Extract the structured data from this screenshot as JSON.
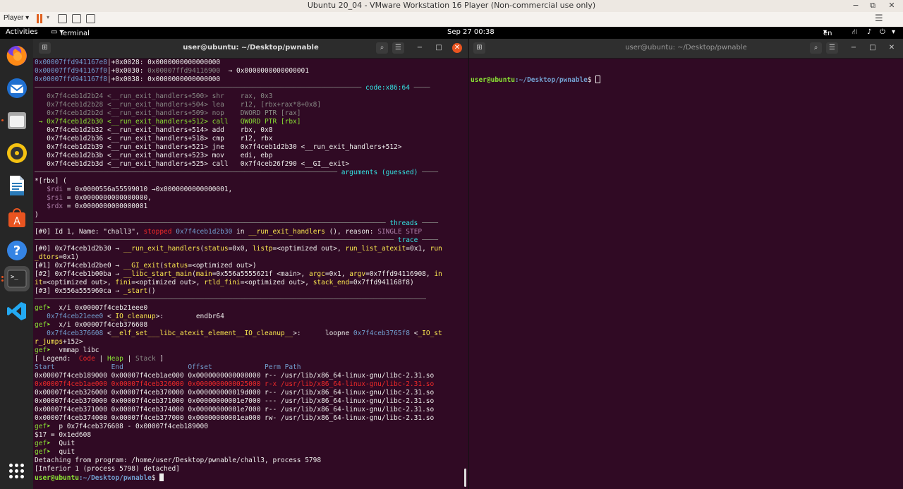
{
  "vmware": {
    "title": "Ubuntu 20_04 - VMware Workstation 16 Player (Non-commercial use only)",
    "player_menu": "Player",
    "minimize": "−",
    "restore": "⧉",
    "close": "✕",
    "accent": "#e0611f"
  },
  "topbar": {
    "activities": "Activities",
    "app_menu": "Terminal",
    "clock": "Sep 27  00:38",
    "lang": "en"
  },
  "dock": {
    "items": [
      "firefox-icon",
      "thunderbird-icon",
      "files-icon",
      "rhythmbox-icon",
      "libreoffice-writer-icon",
      "ubuntu-software-icon",
      "help-icon",
      "terminal-icon",
      "vscode-icon"
    ],
    "apps_grid": "show-applications-icon"
  },
  "left_terminal": {
    "title": "user@ubuntu: ~/Desktop/pwnable",
    "lines": [
      [
        [
          "b",
          "0x00007ffd941167e8"
        ],
        [
          "w",
          "│+0x0028: 0x0000000000000000"
        ]
      ],
      [
        [
          "b",
          "0x00007ffd941167f0"
        ],
        [
          "w",
          "│+0x0030: "
        ],
        [
          "gy",
          "0x00007ffd94116900"
        ],
        [
          "w",
          "  → 0x0000000000000001"
        ]
      ],
      [
        [
          "b",
          "0x00007ffd941167f8"
        ],
        [
          "w",
          "│+0x0038: 0x0000000000000000"
        ]
      ],
      [
        [
          "gy",
          "───────────────────────────────────────────────────────────────────────────────── "
        ],
        [
          "c",
          "code:x86:64"
        ],
        [
          "gy",
          " ────"
        ]
      ],
      [
        [
          "gy",
          "   0x7f4ceb1d2b24 <__run_exit_handlers+500> shr    rax, 0x3"
        ]
      ],
      [
        [
          "gy",
          "   0x7f4ceb1d2b28 <__run_exit_handlers+504> lea    r12, [rbx+rax*8+0x8]"
        ]
      ],
      [
        [
          "gy",
          "   0x7f4ceb1d2b2d <__run_exit_handlers+509> nop    DWORD PTR [rax]"
        ]
      ],
      [
        [
          "g",
          " → 0x7f4ceb1d2b30 <__run_exit_handlers+512> call   QWORD PTR [rbx]"
        ]
      ],
      [
        [
          "w",
          "   0x7f4ceb1d2b32 <__run_exit_handlers+514> add    rbx, 0x8"
        ]
      ],
      [
        [
          "w",
          "   0x7f4ceb1d2b36 <__run_exit_handlers+518> cmp    r12, rbx"
        ]
      ],
      [
        [
          "w",
          "   0x7f4ceb1d2b39 <__run_exit_handlers+521> jne    0x7f4ceb1d2b30 <__run_exit_handlers+512>"
        ]
      ],
      [
        [
          "w",
          "   0x7f4ceb1d2b3b <__run_exit_handlers+523> mov    edi, ebp"
        ]
      ],
      [
        [
          "w",
          "   0x7f4ceb1d2b3d <__run_exit_handlers+525> call   0x7f4ceb26f290 <__GI__exit>"
        ]
      ],
      [
        [
          "gy",
          "─────────────────────────────────────────────────────────────────────────── "
        ],
        [
          "c",
          "arguments (guessed)"
        ],
        [
          "gy",
          " ────"
        ]
      ],
      [
        [
          "w",
          "*[rbx] ("
        ]
      ],
      [
        [
          "w",
          "   "
        ],
        [
          "p",
          "$rdi"
        ],
        [
          "w",
          " = 0x0000556a55599010 →0x0000000000000001,"
        ]
      ],
      [
        [
          "w",
          "   "
        ],
        [
          "p",
          "$rsi"
        ],
        [
          "w",
          " = 0x0000000000000000,"
        ]
      ],
      [
        [
          "w",
          "   "
        ],
        [
          "p",
          "$rdx"
        ],
        [
          "w",
          " = 0x0000000000000001"
        ]
      ],
      [
        [
          "w",
          ")"
        ]
      ],
      [
        [
          "gy",
          "─────────────────────────────────────────────────────────────────────────────────────── "
        ],
        [
          "c",
          "threads"
        ],
        [
          "gy",
          " ────"
        ]
      ],
      [
        [
          "w",
          "[#0] Id 1, Name: \"chall3\", "
        ],
        [
          "r",
          "stopped"
        ],
        [
          "w",
          " "
        ],
        [
          "b",
          "0x7f4ceb1d2b30"
        ],
        [
          "w",
          " in "
        ],
        [
          "y",
          "__run_exit_handlers"
        ],
        [
          "w",
          " (), reason: "
        ],
        [
          "p",
          "SINGLE STEP"
        ]
      ],
      [
        [
          "gy",
          "───────────────────────────────────────────────────────────────────────────────────────── "
        ],
        [
          "c",
          "trace"
        ],
        [
          "gy",
          " ────"
        ]
      ],
      [
        [
          "w",
          "[#0] 0x7f4ceb1d2b30 → "
        ],
        [
          "y",
          "__run_exit_handlers"
        ],
        [
          "w",
          "("
        ],
        [
          "y",
          "status"
        ],
        [
          "w",
          "=0x0, "
        ],
        [
          "y",
          "listp"
        ],
        [
          "w",
          "=<optimized out>, "
        ],
        [
          "y",
          "run_list_atexit"
        ],
        [
          "w",
          "=0x1, "
        ],
        [
          "y",
          "run"
        ]
      ],
      [
        [
          "y",
          "_dtors"
        ],
        [
          "w",
          "=0x1)"
        ]
      ],
      [
        [
          "w",
          "[#1] 0x7f4ceb1d2be0 → "
        ],
        [
          "y",
          "__GI_exit"
        ],
        [
          "w",
          "("
        ],
        [
          "y",
          "status"
        ],
        [
          "w",
          "=<optimized out>)"
        ]
      ],
      [
        [
          "w",
          "[#2] 0x7f4ceb1b00ba → "
        ],
        [
          "y",
          "__libc_start_main"
        ],
        [
          "w",
          "("
        ],
        [
          "y",
          "main"
        ],
        [
          "w",
          "=0x556a5555621f <main>, "
        ],
        [
          "y",
          "argc"
        ],
        [
          "w",
          "=0x1, "
        ],
        [
          "y",
          "argv"
        ],
        [
          "w",
          "=0x7ffd94116908, "
        ],
        [
          "y",
          "in"
        ]
      ],
      [
        [
          "y",
          "it"
        ],
        [
          "w",
          "=<optimized out>, "
        ],
        [
          "y",
          "fini"
        ],
        [
          "w",
          "=<optimized out>, "
        ],
        [
          "y",
          "rtld_fini"
        ],
        [
          "w",
          "=<optimized out>, "
        ],
        [
          "y",
          "stack_end"
        ],
        [
          "w",
          "=0x7ffd941168f8)"
        ]
      ],
      [
        [
          "w",
          "[#3] 0x556a555960ca → "
        ],
        [
          "y",
          "_start"
        ],
        [
          "w",
          "()"
        ]
      ],
      [
        [
          "gy",
          "─────────────────────────────────────────────────────────────────────────────────────────────────"
        ]
      ],
      [
        [
          "g",
          "gef➤"
        ],
        [
          "w",
          "  x/i 0x00007f4ceb21eee0"
        ]
      ],
      [
        [
          "w",
          "   "
        ],
        [
          "b",
          "0x7f4ceb21eee0"
        ],
        [
          "w",
          " <"
        ],
        [
          "y",
          "_IO_cleanup"
        ],
        [
          "w",
          ">:        endbr64"
        ]
      ],
      [
        [
          "g",
          "gef➤"
        ],
        [
          "w",
          "  x/i 0x00007f4ceb376608"
        ]
      ],
      [
        [
          "w",
          "   "
        ],
        [
          "b",
          "0x7f4ceb376608"
        ],
        [
          "w",
          " <"
        ],
        [
          "y",
          "__elf_set___libc_atexit_element__IO_cleanup__"
        ],
        [
          "w",
          ">:      loopne "
        ],
        [
          "b",
          "0x7f4ceb3765f8"
        ],
        [
          "w",
          " <"
        ],
        [
          "y",
          "_IO_st"
        ]
      ],
      [
        [
          "y",
          "r_jumps"
        ],
        [
          "w",
          "+152>"
        ]
      ],
      [
        [
          "g",
          "gef➤"
        ],
        [
          "w",
          "  vmmap libc"
        ]
      ],
      [
        [
          "w",
          "[ Legend:  "
        ],
        [
          "r",
          "Code"
        ],
        [
          "w",
          " | "
        ],
        [
          "g",
          "Heap"
        ],
        [
          "w",
          " | "
        ],
        [
          "gy",
          "Stack"
        ],
        [
          "w",
          " ]"
        ]
      ],
      [
        [
          "b",
          "Start              End                Offset             Perm Path"
        ]
      ],
      [
        [
          "w",
          "0x00007f4ceb189000 0x00007f4ceb1ae000 0x0000000000000000 r-- /usr/lib/x86_64-linux-gnu/libc-2.31.so"
        ]
      ],
      [
        [
          "r",
          "0x00007f4ceb1ae000 0x00007f4ceb326000 0x0000000000025000 r-x /usr/lib/x86_64-linux-gnu/libc-2.31.so"
        ]
      ],
      [
        [
          "w",
          "0x00007f4ceb326000 0x00007f4ceb370000 0x000000000019d000 r-- /usr/lib/x86_64-linux-gnu/libc-2.31.so"
        ]
      ],
      [
        [
          "w",
          "0x00007f4ceb370000 0x00007f4ceb371000 0x00000000001e7000 --- /usr/lib/x86_64-linux-gnu/libc-2.31.so"
        ]
      ],
      [
        [
          "w",
          "0x00007f4ceb371000 0x00007f4ceb374000 0x00000000001e7000 r-- /usr/lib/x86_64-linux-gnu/libc-2.31.so"
        ]
      ],
      [
        [
          "w",
          "0x00007f4ceb374000 0x00007f4ceb377000 0x00000000001ea000 rw- /usr/lib/x86_64-linux-gnu/libc-2.31.so"
        ]
      ],
      [
        [
          "g",
          "gef➤"
        ],
        [
          "w",
          "  p 0x7f4ceb376608 - 0x00007f4ceb189000"
        ]
      ],
      [
        [
          "w",
          "$17 = 0x1ed608"
        ]
      ],
      [
        [
          "g",
          "gef➤"
        ],
        [
          "w",
          "  Quit"
        ]
      ],
      [
        [
          "g",
          "gef➤"
        ],
        [
          "w",
          "  quit"
        ]
      ],
      [
        [
          "w",
          "Detaching from program: /home/user/Desktop/pwnable/chall3, process 5798"
        ]
      ],
      [
        [
          "w",
          "[Inferior 1 (process 5798) detached]"
        ]
      ]
    ],
    "prompt_user": "user@ubuntu",
    "prompt_path": ":~/Desktop/pwnable",
    "prompt_sign": "$ "
  },
  "right_terminal": {
    "title": "user@ubuntu: ~/Desktop/pwnable",
    "prompt_user": "user@ubuntu",
    "prompt_path": ":~/Desktop/pwnable",
    "prompt_sign": "$ "
  },
  "colors": {
    "terminal_bg": "#300a24",
    "ubuntu_orange": "#e95420"
  }
}
